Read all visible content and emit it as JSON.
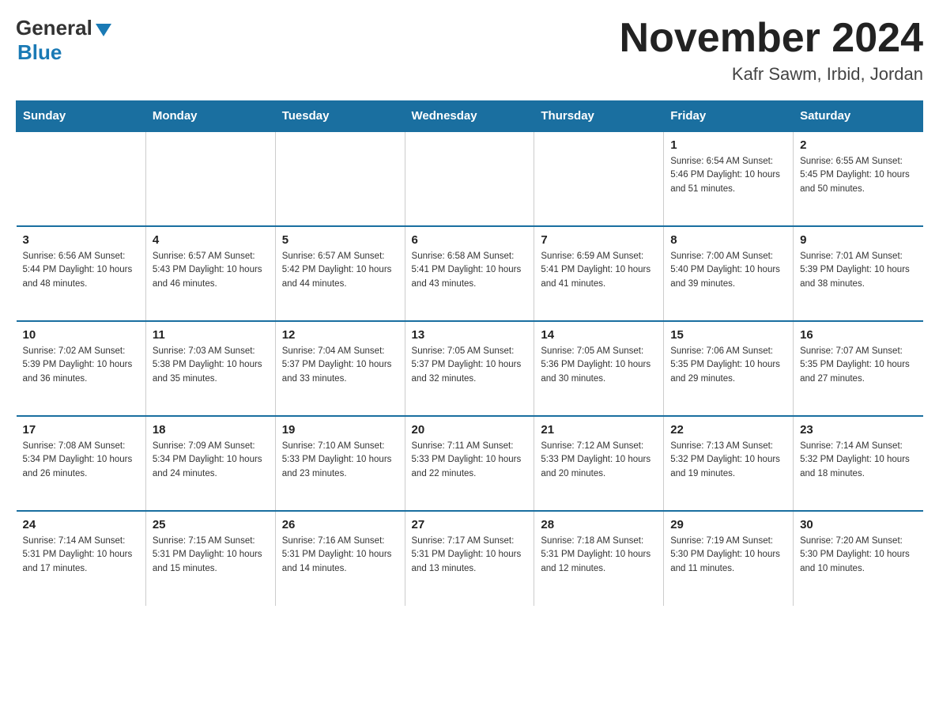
{
  "header": {
    "logo_general": "General",
    "logo_blue": "Blue",
    "month_title": "November 2024",
    "location": "Kafr Sawm, Irbid, Jordan"
  },
  "days_of_week": [
    "Sunday",
    "Monday",
    "Tuesday",
    "Wednesday",
    "Thursday",
    "Friday",
    "Saturday"
  ],
  "weeks": [
    [
      {
        "day": "",
        "info": ""
      },
      {
        "day": "",
        "info": ""
      },
      {
        "day": "",
        "info": ""
      },
      {
        "day": "",
        "info": ""
      },
      {
        "day": "",
        "info": ""
      },
      {
        "day": "1",
        "info": "Sunrise: 6:54 AM\nSunset: 5:46 PM\nDaylight: 10 hours and 51 minutes."
      },
      {
        "day": "2",
        "info": "Sunrise: 6:55 AM\nSunset: 5:45 PM\nDaylight: 10 hours and 50 minutes."
      }
    ],
    [
      {
        "day": "3",
        "info": "Sunrise: 6:56 AM\nSunset: 5:44 PM\nDaylight: 10 hours and 48 minutes."
      },
      {
        "day": "4",
        "info": "Sunrise: 6:57 AM\nSunset: 5:43 PM\nDaylight: 10 hours and 46 minutes."
      },
      {
        "day": "5",
        "info": "Sunrise: 6:57 AM\nSunset: 5:42 PM\nDaylight: 10 hours and 44 minutes."
      },
      {
        "day": "6",
        "info": "Sunrise: 6:58 AM\nSunset: 5:41 PM\nDaylight: 10 hours and 43 minutes."
      },
      {
        "day": "7",
        "info": "Sunrise: 6:59 AM\nSunset: 5:41 PM\nDaylight: 10 hours and 41 minutes."
      },
      {
        "day": "8",
        "info": "Sunrise: 7:00 AM\nSunset: 5:40 PM\nDaylight: 10 hours and 39 minutes."
      },
      {
        "day": "9",
        "info": "Sunrise: 7:01 AM\nSunset: 5:39 PM\nDaylight: 10 hours and 38 minutes."
      }
    ],
    [
      {
        "day": "10",
        "info": "Sunrise: 7:02 AM\nSunset: 5:39 PM\nDaylight: 10 hours and 36 minutes."
      },
      {
        "day": "11",
        "info": "Sunrise: 7:03 AM\nSunset: 5:38 PM\nDaylight: 10 hours and 35 minutes."
      },
      {
        "day": "12",
        "info": "Sunrise: 7:04 AM\nSunset: 5:37 PM\nDaylight: 10 hours and 33 minutes."
      },
      {
        "day": "13",
        "info": "Sunrise: 7:05 AM\nSunset: 5:37 PM\nDaylight: 10 hours and 32 minutes."
      },
      {
        "day": "14",
        "info": "Sunrise: 7:05 AM\nSunset: 5:36 PM\nDaylight: 10 hours and 30 minutes."
      },
      {
        "day": "15",
        "info": "Sunrise: 7:06 AM\nSunset: 5:35 PM\nDaylight: 10 hours and 29 minutes."
      },
      {
        "day": "16",
        "info": "Sunrise: 7:07 AM\nSunset: 5:35 PM\nDaylight: 10 hours and 27 minutes."
      }
    ],
    [
      {
        "day": "17",
        "info": "Sunrise: 7:08 AM\nSunset: 5:34 PM\nDaylight: 10 hours and 26 minutes."
      },
      {
        "day": "18",
        "info": "Sunrise: 7:09 AM\nSunset: 5:34 PM\nDaylight: 10 hours and 24 minutes."
      },
      {
        "day": "19",
        "info": "Sunrise: 7:10 AM\nSunset: 5:33 PM\nDaylight: 10 hours and 23 minutes."
      },
      {
        "day": "20",
        "info": "Sunrise: 7:11 AM\nSunset: 5:33 PM\nDaylight: 10 hours and 22 minutes."
      },
      {
        "day": "21",
        "info": "Sunrise: 7:12 AM\nSunset: 5:33 PM\nDaylight: 10 hours and 20 minutes."
      },
      {
        "day": "22",
        "info": "Sunrise: 7:13 AM\nSunset: 5:32 PM\nDaylight: 10 hours and 19 minutes."
      },
      {
        "day": "23",
        "info": "Sunrise: 7:14 AM\nSunset: 5:32 PM\nDaylight: 10 hours and 18 minutes."
      }
    ],
    [
      {
        "day": "24",
        "info": "Sunrise: 7:14 AM\nSunset: 5:31 PM\nDaylight: 10 hours and 17 minutes."
      },
      {
        "day": "25",
        "info": "Sunrise: 7:15 AM\nSunset: 5:31 PM\nDaylight: 10 hours and 15 minutes."
      },
      {
        "day": "26",
        "info": "Sunrise: 7:16 AM\nSunset: 5:31 PM\nDaylight: 10 hours and 14 minutes."
      },
      {
        "day": "27",
        "info": "Sunrise: 7:17 AM\nSunset: 5:31 PM\nDaylight: 10 hours and 13 minutes."
      },
      {
        "day": "28",
        "info": "Sunrise: 7:18 AM\nSunset: 5:31 PM\nDaylight: 10 hours and 12 minutes."
      },
      {
        "day": "29",
        "info": "Sunrise: 7:19 AM\nSunset: 5:30 PM\nDaylight: 10 hours and 11 minutes."
      },
      {
        "day": "30",
        "info": "Sunrise: 7:20 AM\nSunset: 5:30 PM\nDaylight: 10 hours and 10 minutes."
      }
    ]
  ]
}
